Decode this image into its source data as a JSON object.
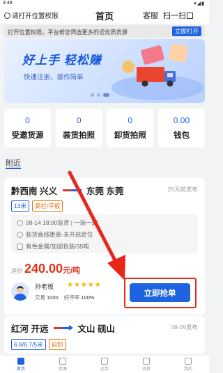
{
  "status_bar": {
    "time": "3:48",
    "icons": "▾◢▮"
  },
  "topnav": {
    "location_label": "请打开位置权限",
    "title": "首页",
    "service_label": "客服",
    "scan_label": "扫一扫"
  },
  "permission_bar": {
    "text": "打开位置权限，平台帮您筛选更多附近优质货源",
    "button": "立即打开"
  },
  "banner": {
    "headline": "好上手 轻松赚",
    "subtext": "快速注册，操作简单",
    "slides_total": 3,
    "active_slide": 3
  },
  "stats": [
    {
      "value": "0",
      "label": "受邀货源"
    },
    {
      "value": "0",
      "label": "装货拍照"
    },
    {
      "value": "0",
      "label": "卸货拍照"
    },
    {
      "value": "0.00",
      "label": "钱包"
    }
  ],
  "section_title": "附近",
  "listing1": {
    "from": "黔西南 兴义",
    "to": "东莞 东莞",
    "posted": "25天前发布",
    "tags": [
      "13米",
      "高栏/平板"
    ],
    "schedule": "08-14 18:00装货 | 一装一卸",
    "distance": "装货直线距离-未开启定位",
    "cargo": "有色金属/加固包装/35吨",
    "price_prefix": "运价",
    "price": "240.00",
    "price_unit": "元/吨",
    "shipper_name": "孙老板",
    "stars": "★★★★★",
    "rating": 5,
    "trade_label": "交易",
    "trade_count": "1000",
    "praise_label": "好评率",
    "praise_rate": "100%",
    "grab_button": "立即抢单"
  },
  "listing2": {
    "from": "红河 开远",
    "to": "文山 砚山",
    "posted": "08-05发布",
    "tags": [
      "6.8/8.7/5米",
      "自卸"
    ]
  },
  "tabbar": [
    {
      "label": "首页",
      "active": true
    },
    {
      "label": "货源",
      "active": false
    },
    {
      "label": "运单",
      "active": false
    },
    {
      "label": "消息",
      "active": false
    },
    {
      "label": "我的",
      "active": false
    }
  ],
  "colors": {
    "primary": "#1e63e0",
    "price": "#e2331b",
    "highlight": "#e8261a",
    "tag_orange": "#e8740e"
  }
}
